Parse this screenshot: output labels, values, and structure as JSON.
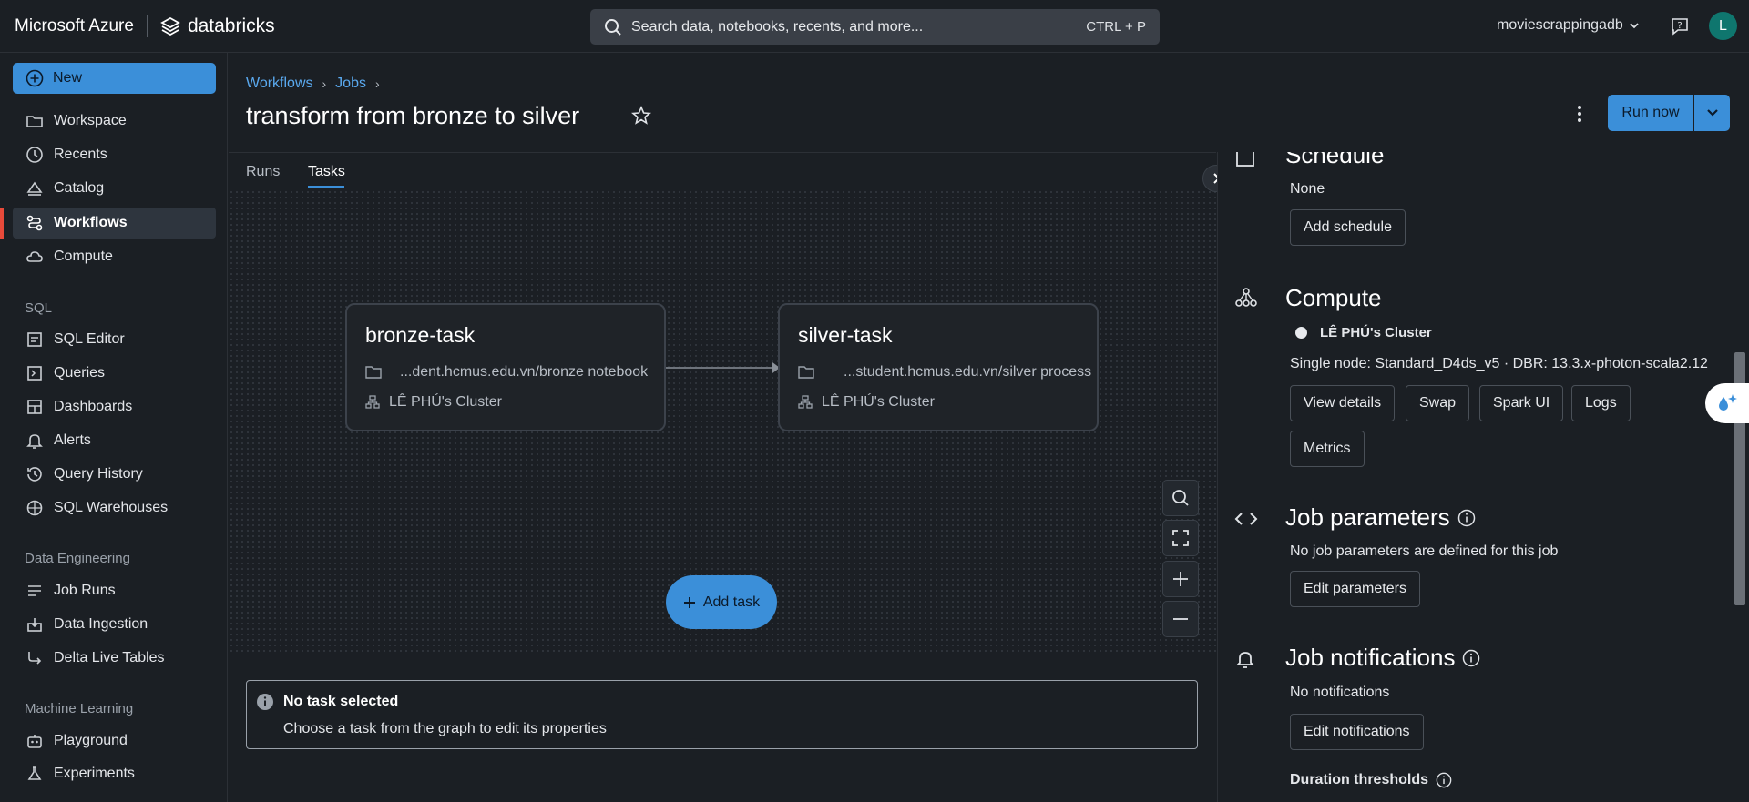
{
  "topbar": {
    "brand_primary": "Microsoft Azure",
    "brand_secondary": "databricks",
    "search_placeholder": "Search data, notebooks, recents, and more...",
    "search_shortcut": "CTRL + P",
    "workspace": "moviescrappingadb",
    "avatar_initial": "L"
  },
  "sidebar": {
    "new_label": "New",
    "items_top": [
      "Workspace",
      "Recents",
      "Catalog",
      "Workflows",
      "Compute"
    ],
    "sql_section": "SQL",
    "items_sql": [
      "SQL Editor",
      "Queries",
      "Dashboards",
      "Alerts",
      "Query History",
      "SQL Warehouses"
    ],
    "de_section": "Data Engineering",
    "items_de": [
      "Job Runs",
      "Data Ingestion",
      "Delta Live Tables"
    ],
    "ml_section": "Machine Learning",
    "items_ml": [
      "Playground",
      "Experiments"
    ]
  },
  "header": {
    "breadcrumb": [
      "Workflows",
      "Jobs"
    ],
    "title": "transform from bronze to silver",
    "run_now": "Run now"
  },
  "tabs": [
    "Runs",
    "Tasks"
  ],
  "tasks": [
    {
      "name": "bronze-task",
      "path": "...dent.hcmus.edu.vn/bronze notebook",
      "cluster": "LÊ PHÚ's Cluster"
    },
    {
      "name": "silver-task",
      "path": "...student.hcmus.edu.vn/silver process",
      "cluster": "LÊ PHÚ's Cluster"
    }
  ],
  "add_task": "Add task",
  "no_task": {
    "title": "No task selected",
    "subtitle": "Choose a task from the graph to edit its properties"
  },
  "panel": {
    "schedule": {
      "title": "Schedule",
      "value": "None",
      "button": "Add schedule"
    },
    "compute": {
      "title": "Compute",
      "cluster_name": "LÊ PHÚ's Cluster",
      "details": "Single node: Standard_D4ds_v5 · DBR: 13.3.x-photon-scala2.12",
      "buttons": [
        "View details",
        "Swap",
        "Spark UI",
        "Logs",
        "Metrics"
      ]
    },
    "parameters": {
      "title": "Job parameters",
      "value": "No job parameters are defined for this job",
      "button": "Edit parameters"
    },
    "notifications": {
      "title": "Job notifications",
      "value": "No notifications",
      "button": "Edit notifications"
    },
    "duration_title": "Duration thresholds"
  },
  "colors": {
    "accent": "#3b8fd9",
    "active_marker": "#e84a3a",
    "background": "#1b1f24"
  }
}
